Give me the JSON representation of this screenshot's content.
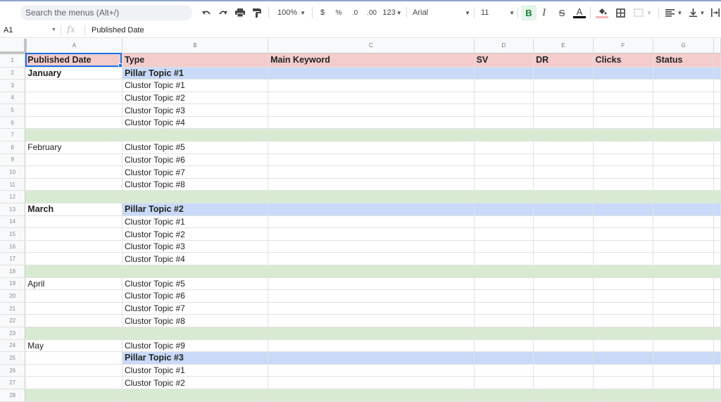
{
  "toolbar": {
    "search_placeholder": "Search the menus (Alt+/)",
    "zoom": "100%",
    "currency": "$",
    "percent": "%",
    "dec_decrease": ".0",
    "dec_increase": ".00",
    "format_more": "123",
    "font": "Arial",
    "font_size": "11",
    "bold": "B",
    "italic": "I",
    "strike": "S",
    "text_color": "A"
  },
  "formula_bar": {
    "cell_ref": "A1",
    "fx": "fx",
    "value": "Published Date"
  },
  "columns": [
    "A",
    "B",
    "C",
    "D",
    "E",
    "F",
    "G"
  ],
  "colors": {
    "header": "#f4cccc",
    "pillar": "#c9daf8",
    "spacer": "#d9ead3",
    "accent": "#1a73e8"
  },
  "rows": [
    {
      "n": "1",
      "type": "header",
      "cells": [
        "Published Date",
        "Type",
        "Main Keyword",
        "SV",
        "DR",
        "Clicks",
        "Status"
      ]
    },
    {
      "n": "2",
      "type": "pillar",
      "cells": [
        "January",
        "Pillar Topic #1",
        "",
        "",
        "",
        "",
        ""
      ]
    },
    {
      "n": "3",
      "type": "normal",
      "cells": [
        "",
        "Clustor Topic #1",
        "",
        "",
        "",
        "",
        ""
      ]
    },
    {
      "n": "4",
      "type": "normal",
      "cells": [
        "",
        "Clustor Topic #2",
        "",
        "",
        "",
        "",
        ""
      ]
    },
    {
      "n": "5",
      "type": "normal",
      "cells": [
        "",
        "Clustor Topic #3",
        "",
        "",
        "",
        "",
        ""
      ]
    },
    {
      "n": "6",
      "type": "normal",
      "cells": [
        "",
        "Clustor Topic #4",
        "",
        "",
        "",
        "",
        ""
      ]
    },
    {
      "n": "7",
      "type": "spacer",
      "cells": [
        "",
        "",
        "",
        "",
        "",
        "",
        ""
      ]
    },
    {
      "n": "8",
      "type": "normal",
      "cells": [
        "February",
        "Clustor Topic #5",
        "",
        "",
        "",
        "",
        ""
      ]
    },
    {
      "n": "9",
      "type": "normal",
      "cells": [
        "",
        "Clustor Topic #6",
        "",
        "",
        "",
        "",
        ""
      ]
    },
    {
      "n": "10",
      "type": "normal",
      "cells": [
        "",
        "Clustor Topic #7",
        "",
        "",
        "",
        "",
        ""
      ]
    },
    {
      "n": "11",
      "type": "normal",
      "cells": [
        "",
        "Clustor Topic #8",
        "",
        "",
        "",
        "",
        ""
      ]
    },
    {
      "n": "12",
      "type": "spacer",
      "cells": [
        "",
        "",
        "",
        "",
        "",
        "",
        ""
      ]
    },
    {
      "n": "13",
      "type": "pillar",
      "cells": [
        "March",
        "Pillar Topic #2",
        "",
        "",
        "",
        "",
        ""
      ]
    },
    {
      "n": "14",
      "type": "normal",
      "cells": [
        "",
        "Clustor Topic #1",
        "",
        "",
        "",
        "",
        ""
      ]
    },
    {
      "n": "15",
      "type": "normal",
      "cells": [
        "",
        "Clustor Topic #2",
        "",
        "",
        "",
        "",
        ""
      ]
    },
    {
      "n": "16",
      "type": "normal",
      "cells": [
        "",
        "Clustor Topic #3",
        "",
        "",
        "",
        "",
        ""
      ]
    },
    {
      "n": "17",
      "type": "normal",
      "cells": [
        "",
        "Clustor Topic #4",
        "",
        "",
        "",
        "",
        ""
      ]
    },
    {
      "n": "18",
      "type": "spacer",
      "cells": [
        "",
        "",
        "",
        "",
        "",
        "",
        ""
      ]
    },
    {
      "n": "19",
      "type": "normal",
      "cells": [
        "April",
        "Clustor Topic #5",
        "",
        "",
        "",
        "",
        ""
      ]
    },
    {
      "n": "20",
      "type": "normal",
      "cells": [
        "",
        "Clustor Topic #6",
        "",
        "",
        "",
        "",
        ""
      ]
    },
    {
      "n": "21",
      "type": "normal",
      "cells": [
        "",
        "Clustor Topic #7",
        "",
        "",
        "",
        "",
        ""
      ]
    },
    {
      "n": "22",
      "type": "normal",
      "cells": [
        "",
        "Clustor Topic #8",
        "",
        "",
        "",
        "",
        ""
      ]
    },
    {
      "n": "23",
      "type": "spacer",
      "cells": [
        "",
        "",
        "",
        "",
        "",
        "",
        ""
      ]
    },
    {
      "n": "24",
      "type": "normal",
      "cells": [
        "May",
        "Clustor Topic #9",
        "",
        "",
        "",
        "",
        ""
      ]
    },
    {
      "n": "25",
      "type": "pillar",
      "cells": [
        "",
        "Pillar Topic #3",
        "",
        "",
        "",
        "",
        ""
      ]
    },
    {
      "n": "26",
      "type": "normal",
      "cells": [
        "",
        "Clustor Topic #1",
        "",
        "",
        "",
        "",
        ""
      ]
    },
    {
      "n": "27",
      "type": "normal",
      "cells": [
        "",
        "Clustor Topic #2",
        "",
        "",
        "",
        "",
        ""
      ]
    },
    {
      "n": "28",
      "type": "spacer",
      "cells": [
        "",
        "",
        "",
        "",
        "",
        "",
        ""
      ]
    }
  ]
}
